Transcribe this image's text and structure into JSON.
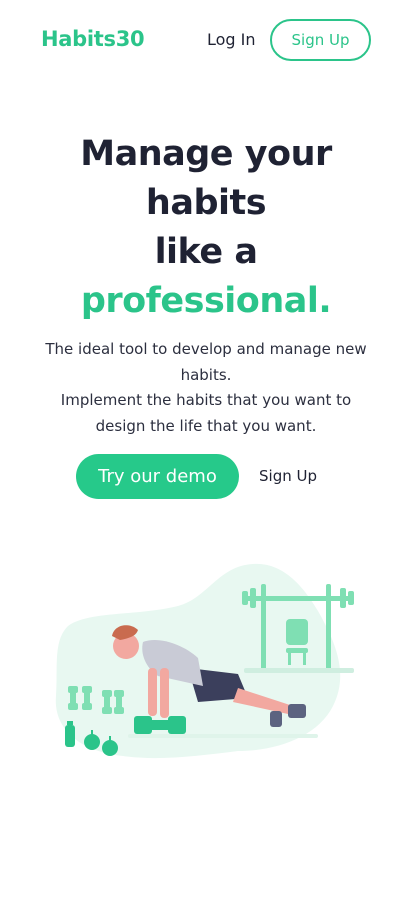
{
  "header": {
    "logo": "Habits30",
    "login_label": "Log In",
    "signup_label": "Sign Up"
  },
  "hero": {
    "title_lines": [
      "Manage your",
      "habits",
      "like a"
    ],
    "title_accent": "professional.",
    "subtitle_lines": [
      "The ideal tool to develop and manage new",
      "habits.",
      "Implement the habits that you want to",
      "design the life that you want."
    ],
    "cta_label": "Try our demo",
    "secondary_label": "Sign Up"
  },
  "illustration": {
    "icon": "workout-pushup-illustration",
    "colors": {
      "accent": "#2bc48a",
      "light_bg": "#e8f8f1",
      "equipment": "#7fdfb3",
      "shirt": "#c9cbd6",
      "shorts": "#3b3f5c",
      "skin": "#f2a8a0",
      "hair": "#c96b4f"
    }
  },
  "colors": {
    "brand": "#2bc48a",
    "text": "#1f2233",
    "background": "#ffffff"
  }
}
